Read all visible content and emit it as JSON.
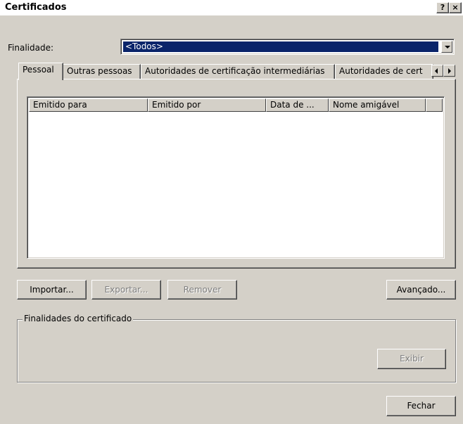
{
  "window": {
    "title": "Certificados",
    "help_button": "?",
    "close_button": "×"
  },
  "purpose": {
    "label": "Finalidade:",
    "selected": "<Todos>"
  },
  "tabs": [
    {
      "label": "Pessoal"
    },
    {
      "label": "Outras pessoas"
    },
    {
      "label": "Autoridades de certificação intermediárias"
    },
    {
      "label": "Autoridades de cert"
    }
  ],
  "columns": [
    {
      "label": "Emitido para"
    },
    {
      "label": "Emitido por"
    },
    {
      "label": "Data de ..."
    },
    {
      "label": "Nome amigável"
    },
    {
      "label": ""
    }
  ],
  "buttons": {
    "import": "Importar...",
    "export": "Exportar...",
    "remove": "Remover",
    "advanced": "Avançado...",
    "view": "Exibir",
    "close": "Fechar"
  },
  "group": {
    "label": "Finalidades do certificado"
  }
}
